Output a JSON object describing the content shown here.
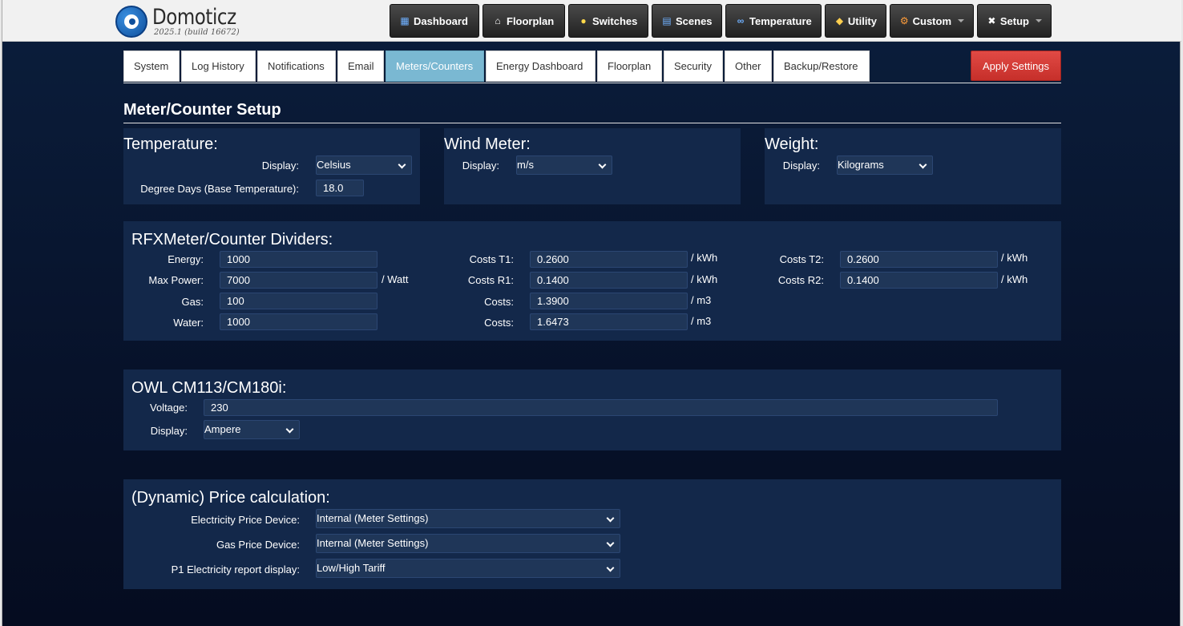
{
  "app": {
    "name": "Domoticz",
    "version": "2025.1 (build 16672)"
  },
  "nav": {
    "items": [
      {
        "label": "Dashboard",
        "icon": "dashboard-icon"
      },
      {
        "label": "Floorplan",
        "icon": "house-icon"
      },
      {
        "label": "Switches",
        "icon": "bulb-icon"
      },
      {
        "label": "Scenes",
        "icon": "film-icon"
      },
      {
        "label": "Temperature",
        "icon": "thermometer-icon"
      },
      {
        "label": "Utility",
        "icon": "utility-icon"
      },
      {
        "label": "Custom",
        "icon": "gear-icon"
      },
      {
        "label": "Setup",
        "icon": "tools-icon"
      }
    ]
  },
  "tabs": [
    {
      "label": "System"
    },
    {
      "label": "Log History"
    },
    {
      "label": "Notifications"
    },
    {
      "label": "Email"
    },
    {
      "label": "Meters/Counters",
      "active": true
    },
    {
      "label": "Energy Dashboard"
    },
    {
      "label": "Floorplan"
    },
    {
      "label": "Security"
    },
    {
      "label": "Other"
    },
    {
      "label": "Backup/Restore"
    }
  ],
  "apply_label": "Apply Settings",
  "page_title": "Meter/Counter Setup",
  "temperature": {
    "title": "Temperature:",
    "display_label": "Display:",
    "display_value": "Celsius",
    "degree_days_label": "Degree Days (Base Temperature):",
    "degree_days_value": "18.0"
  },
  "wind": {
    "title": "Wind Meter:",
    "display_label": "Display:",
    "display_value": "m/s"
  },
  "weight": {
    "title": "Weight:",
    "display_label": "Display:",
    "display_value": "Kilograms"
  },
  "rfx": {
    "title": "RFXMeter/Counter Dividers:",
    "energy_label": "Energy:",
    "energy_value": "1000",
    "maxpower_label": "Max Power:",
    "maxpower_value": "7000",
    "maxpower_unit": "/ Watt",
    "gas_label": "Gas:",
    "gas_value": "100",
    "water_label": "Water:",
    "water_value": "1000",
    "costs_t1_label": "Costs T1:",
    "costs_t1_value": "0.2600",
    "costs_t1_unit": "/ kWh",
    "costs_r1_label": "Costs R1:",
    "costs_r1_value": "0.1400",
    "costs_r1_unit": "/ kWh",
    "costs_gas_label": "Costs:",
    "costs_gas_value": "1.3900",
    "costs_gas_unit": "/ m3",
    "costs_water_label": "Costs:",
    "costs_water_value": "1.6473",
    "costs_water_unit": "/ m3",
    "costs_t2_label": "Costs T2:",
    "costs_t2_value": "0.2600",
    "costs_t2_unit": "/ kWh",
    "costs_r2_label": "Costs R2:",
    "costs_r2_value": "0.1400",
    "costs_r2_unit": "/ kWh"
  },
  "owl": {
    "title": "OWL CM113/CM180i:",
    "voltage_label": "Voltage:",
    "voltage_value": "230",
    "display_label": "Display:",
    "display_value": "Ampere"
  },
  "price": {
    "title": "(Dynamic) Price calculation:",
    "elec_label": "Electricity Price Device:",
    "elec_value": "Internal (Meter Settings)",
    "gas_label": "Gas Price Device:",
    "gas_value": "Internal (Meter Settings)",
    "p1_label": "P1 Electricity report display:",
    "p1_value": "Low/High Tariff"
  }
}
